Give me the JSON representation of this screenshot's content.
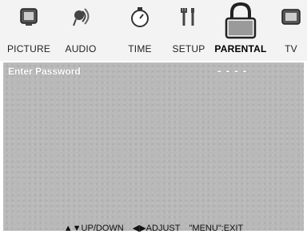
{
  "menu": {
    "tabs": [
      {
        "label": "PICTURE",
        "icon": "picture-icon",
        "active": false
      },
      {
        "label": "AUDIO",
        "icon": "audio-icon",
        "active": false
      },
      {
        "label": "TIME",
        "icon": "stopwatch-icon",
        "active": false
      },
      {
        "label": "SETUP",
        "icon": "tools-icon",
        "active": false
      },
      {
        "label": "PARENTAL",
        "icon": "lock-icon",
        "active": true
      },
      {
        "label": "TV",
        "icon": "tv-icon",
        "active": false
      }
    ]
  },
  "panel": {
    "prompt": "Enter Password",
    "password_placeholder": "- - - -"
  },
  "footer": {
    "updown": "▲▼UP/DOWN",
    "adjust": "◀▶ADJUST",
    "exit": "\"MENU\":EXIT"
  },
  "colors": {
    "panel_bg": "#b9b9b9",
    "text_light": "#ffffff"
  }
}
